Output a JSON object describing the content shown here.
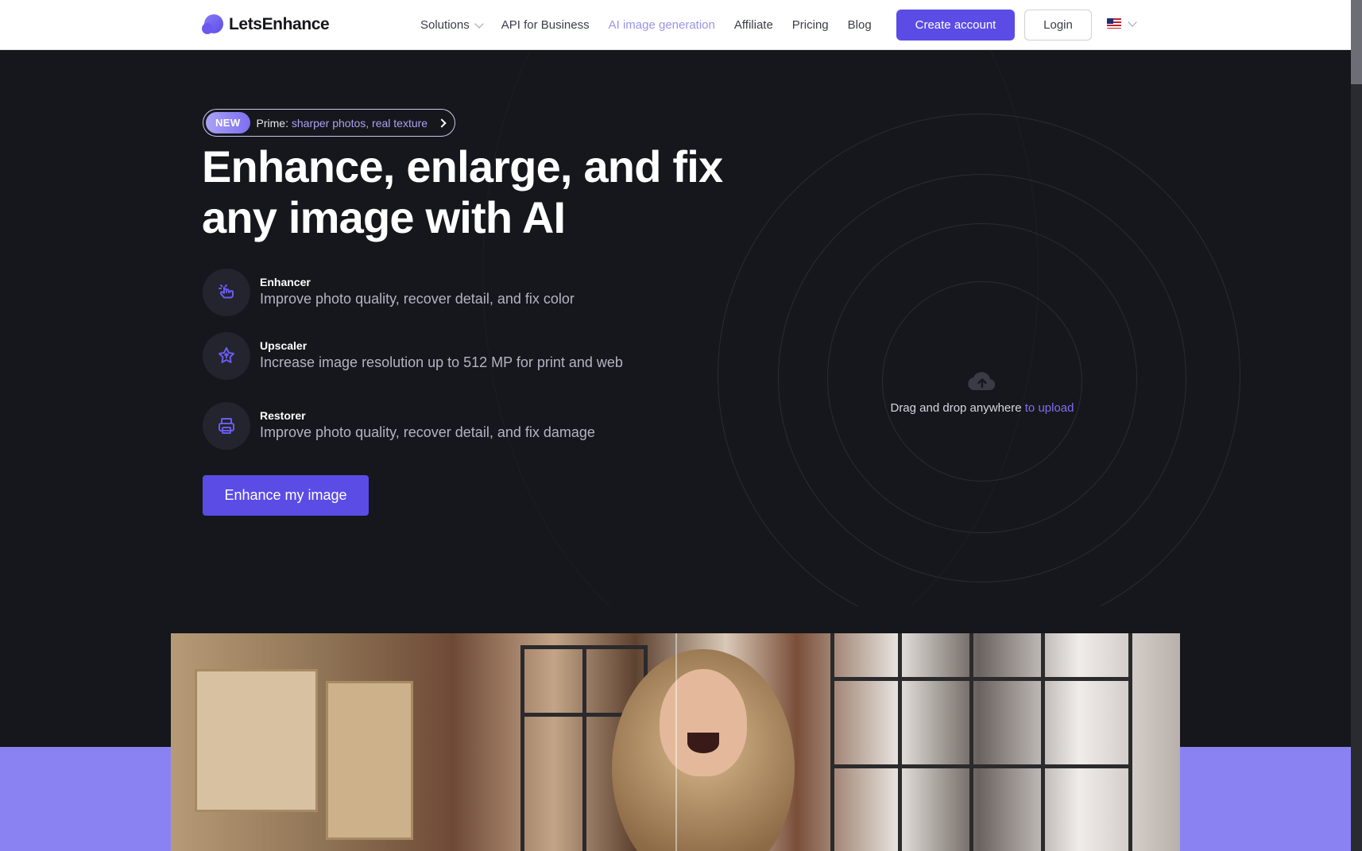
{
  "brand": {
    "name": "LetsEnhance"
  },
  "nav": {
    "links": [
      {
        "label": "Solutions",
        "has_dropdown": true
      },
      {
        "label": "API for Business"
      },
      {
        "label": "AI image generation",
        "active": true
      },
      {
        "label": "Affiliate"
      },
      {
        "label": "Pricing"
      },
      {
        "label": "Blog"
      }
    ],
    "create_account": "Create account",
    "login": "Login",
    "language_icon": "us-flag-icon"
  },
  "hero": {
    "badge": {
      "tag": "NEW",
      "prefix": "Prime: ",
      "highlight": "sharper photos, real texture"
    },
    "headline": "Enhance, enlarge, and fix any image with AI",
    "features": [
      {
        "title": "Enhancer",
        "description": "Improve photo quality, recover detail, and fix color",
        "icon": "magic-touch-icon"
      },
      {
        "title": "Upscaler",
        "description": "Increase image resolution up to 512 MP for print and web",
        "icon": "star-upscale-icon"
      },
      {
        "title": "Restorer",
        "description": "Improve photo quality, recover detail, and fix damage",
        "icon": "restore-icon"
      }
    ],
    "cta": "Enhance my image",
    "upload": {
      "text": "Drag and drop anywhere ",
      "link": "to upload",
      "icon": "cloud-upload-icon"
    }
  },
  "colors": {
    "accent": "#5b4ce6",
    "accent_light": "#9a94e8",
    "hero_bg": "#16171c",
    "band": "#8a82f2"
  }
}
